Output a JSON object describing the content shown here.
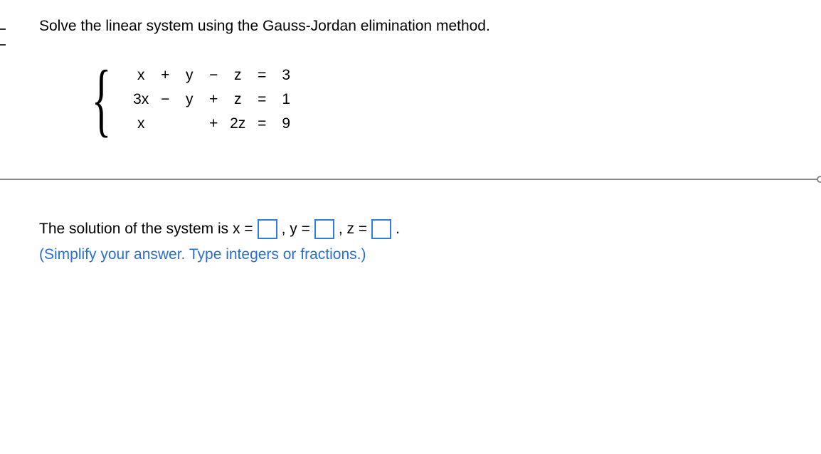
{
  "problem": {
    "statement": "Solve the linear system using the Gauss-Jordan elimination method.",
    "equations": [
      {
        "c1": "x",
        "op1": "+",
        "c2": "y",
        "op2": "−",
        "c3": "z",
        "eq": "=",
        "rhs": "3"
      },
      {
        "c1": "3x",
        "op1": "−",
        "c2": "y",
        "op2": "+",
        "c3": "z",
        "eq": "=",
        "rhs": "1"
      },
      {
        "c1": "x",
        "op1": "",
        "c2": "",
        "op2": "+",
        "c3": "2z",
        "eq": "=",
        "rhs": "9"
      }
    ]
  },
  "answer": {
    "prefix": "The solution of the system is x =",
    "sep_y": ", y =",
    "sep_z": ", z =",
    "period": ".",
    "instruction": "(Simplify your answer. Type integers or fractions.)"
  }
}
